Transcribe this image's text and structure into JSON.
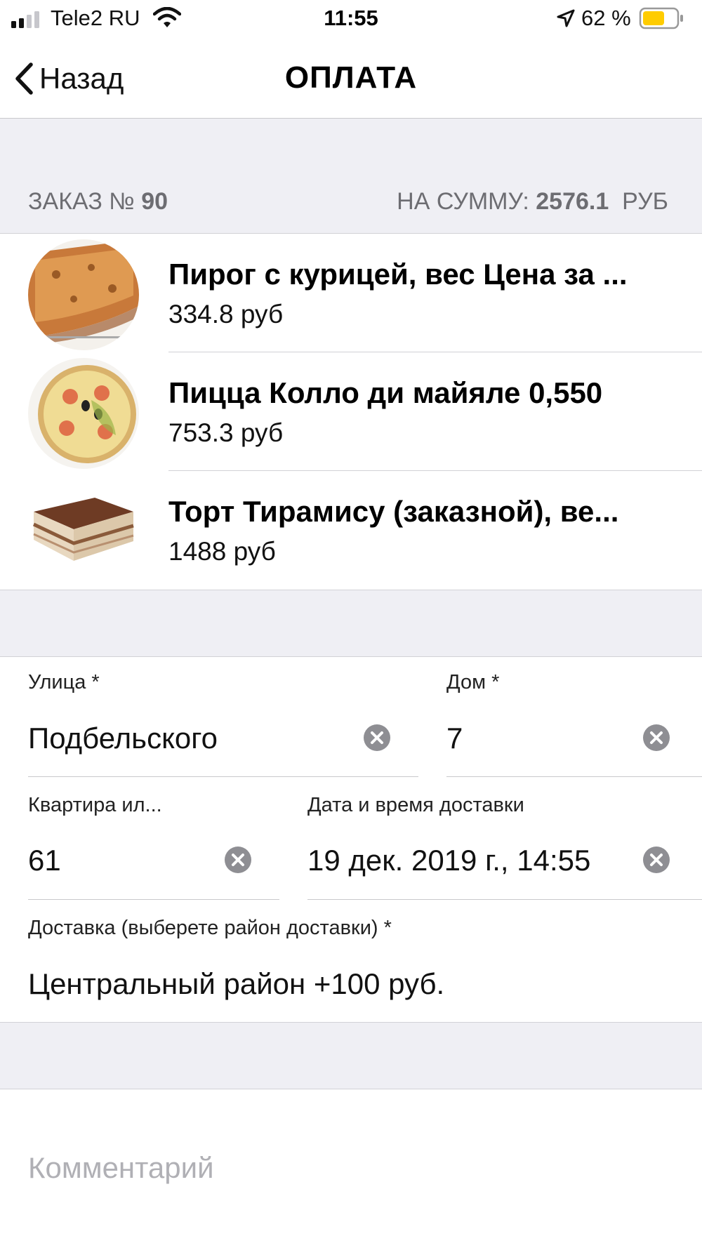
{
  "status_bar": {
    "carrier": "Tele2 RU",
    "time": "11:55",
    "battery_percent": "62 %",
    "battery_color": "#ffcc00"
  },
  "nav": {
    "back_label": "Назад",
    "title": "ОПЛАТА"
  },
  "order": {
    "number_label": "ЗАКАЗ №",
    "number": "90",
    "sum_label": "НА СУММУ:",
    "sum": "2576.1",
    "currency": "РУБ"
  },
  "items": [
    {
      "name": "Пирог с курицей, вес Цена за ...",
      "price": "334.8  руб",
      "thumb": "pie-photo"
    },
    {
      "name": "Пицца Колло ди майяле 0,550",
      "price": "753.3  руб",
      "thumb": "pizza-photo"
    },
    {
      "name": "Торт Тирамису (заказной), ве...",
      "price": "1488  руб",
      "thumb": "cake-photo"
    }
  ],
  "form": {
    "street_label": "Улица *",
    "street_value": "Подбельского",
    "house_label": "Дом *",
    "house_value": "7",
    "apartment_label": "Квартира ил...",
    "apartment_value": "61",
    "datetime_label": "Дата и время доставки",
    "datetime_value": "19 дек. 2019 г., 14:55",
    "delivery_label": "Доставка (выберете район доставки) *",
    "delivery_value": "Центральный район +100 руб.",
    "comment_placeholder": "Комментарий"
  }
}
